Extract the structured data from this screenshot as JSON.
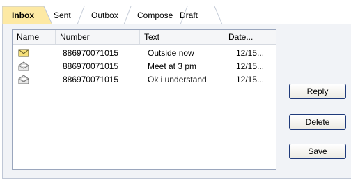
{
  "tabs": [
    {
      "label": "Inbox",
      "active": true
    },
    {
      "label": "Sent",
      "active": false
    },
    {
      "label": "Outbox",
      "active": false
    },
    {
      "label": "Compose",
      "active": false
    },
    {
      "label": "Draft",
      "active": false
    }
  ],
  "list": {
    "columns": [
      "Name",
      "Number",
      "Text",
      "Date..."
    ],
    "rows": [
      {
        "status_icon": "unread-envelope-icon",
        "number": "886970071015",
        "text": "Outside now",
        "date": "12/15..."
      },
      {
        "status_icon": "read-envelope-icon",
        "number": "886970071015",
        "text": "Meet at 3 pm",
        "date": "12/15..."
      },
      {
        "status_icon": "read-envelope-icon",
        "number": "886970071015",
        "text": "Ok i understand",
        "date": "12/15..."
      }
    ]
  },
  "buttons": {
    "reply": "Reply",
    "delete": "Delete",
    "save": "Save"
  },
  "colors": {
    "active_tab": "#fde9a4",
    "tab_border": "#bfc7d6",
    "panel_bg": "#f1f3f7",
    "button_border": "#1f3a7a"
  }
}
